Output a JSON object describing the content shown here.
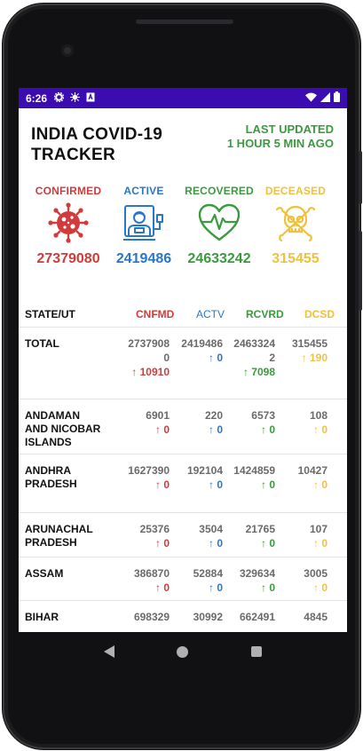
{
  "colors": {
    "confirmed": "#d23b3b",
    "active": "#2a76c9",
    "recovered": "#3a9b3e",
    "deceased": "#f0c13a",
    "statusbar": "#3b0cb0"
  },
  "statusbar": {
    "time": "6:26",
    "icons": [
      "gear-icon",
      "bug-icon",
      "text-icon",
      "wifi-icon",
      "signal-icon",
      "battery-icon"
    ]
  },
  "header": {
    "title": "INDIA COVID-19 TRACKER",
    "updated_line1": "LAST UPDATED",
    "updated_line2": "1 HOUR 5 MIN AGO"
  },
  "stats": {
    "confirmed": {
      "label": "CONFIRMED",
      "value": "27379080"
    },
    "active": {
      "label": "ACTIVE",
      "value": "2419486"
    },
    "recovered": {
      "label": "RECOVERED",
      "value": "24633242"
    },
    "deceased": {
      "label": "DECEASED",
      "value": "315455"
    }
  },
  "table": {
    "headers": {
      "state": "STATE/UT",
      "cnfmd": "CNFMD",
      "actv": "ACTV",
      "rcvrd": "RCVRD",
      "dcsd": "DCSD"
    },
    "rows": [
      {
        "name": "TOTAL",
        "cnfmd": "27379080",
        "cnfmd_d": "↑ 10910",
        "actv": "2419486",
        "actv_d": "↑ 0",
        "rcvrd": "24633242",
        "rcvrd_d": "↑ 7098",
        "dcsd": "315455",
        "dcsd_d": "↑ 190"
      },
      {
        "name": "ANDAMAN AND NICOBAR ISLANDS",
        "cnfmd": "6901",
        "cnfmd_d": "↑ 0",
        "actv": "220",
        "actv_d": "↑ 0",
        "rcvrd": "6573",
        "rcvrd_d": "↑ 0",
        "dcsd": "108",
        "dcsd_d": "↑ 0"
      },
      {
        "name": "ANDHRA PRADESH",
        "cnfmd": "1627390",
        "cnfmd_d": "↑ 0",
        "actv": "192104",
        "actv_d": "↑ 0",
        "rcvrd": "1424859",
        "rcvrd_d": "↑ 0",
        "dcsd": "10427",
        "dcsd_d": "↑ 0"
      },
      {
        "name": "ARUNACHAL PRADESH",
        "cnfmd": "25376",
        "cnfmd_d": "↑ 0",
        "actv": "3504",
        "actv_d": "↑ 0",
        "rcvrd": "21765",
        "rcvrd_d": "↑ 0",
        "dcsd": "107",
        "dcsd_d": "↑ 0"
      },
      {
        "name": "ASSAM",
        "cnfmd": "386870",
        "cnfmd_d": "↑ 0",
        "actv": "52884",
        "actv_d": "↑ 0",
        "rcvrd": "329634",
        "rcvrd_d": "↑ 0",
        "dcsd": "3005",
        "dcsd_d": "↑ 0"
      },
      {
        "name": "BIHAR",
        "cnfmd": "698329",
        "cnfmd_d": "",
        "actv": "30992",
        "actv_d": "",
        "rcvrd": "662491",
        "rcvrd_d": "",
        "dcsd": "4845",
        "dcsd_d": ""
      }
    ]
  },
  "navbar": {
    "icons": [
      "back-icon",
      "home-icon",
      "recents-icon"
    ]
  }
}
